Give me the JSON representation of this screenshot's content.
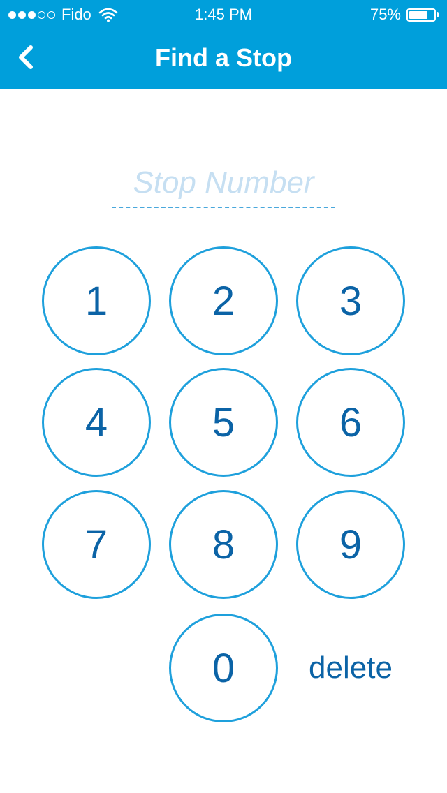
{
  "status_bar": {
    "signal_filled": 3,
    "signal_empty": 2,
    "carrier": "Fido",
    "time": "1:45 PM",
    "battery_percent_label": "75%",
    "battery_level": 0.75
  },
  "nav": {
    "title": "Find a Stop",
    "back_icon": "chevron-left-icon"
  },
  "stop_input": {
    "placeholder": "Stop Number",
    "value": ""
  },
  "keypad": {
    "keys": [
      "1",
      "2",
      "3",
      "4",
      "5",
      "6",
      "7",
      "8",
      "9",
      "0"
    ],
    "delete_label": "delete"
  },
  "colors": {
    "header": "#009fdb",
    "key_border": "#1ea0dc",
    "key_text": "#0b63a6",
    "placeholder": "#c6dff2"
  }
}
